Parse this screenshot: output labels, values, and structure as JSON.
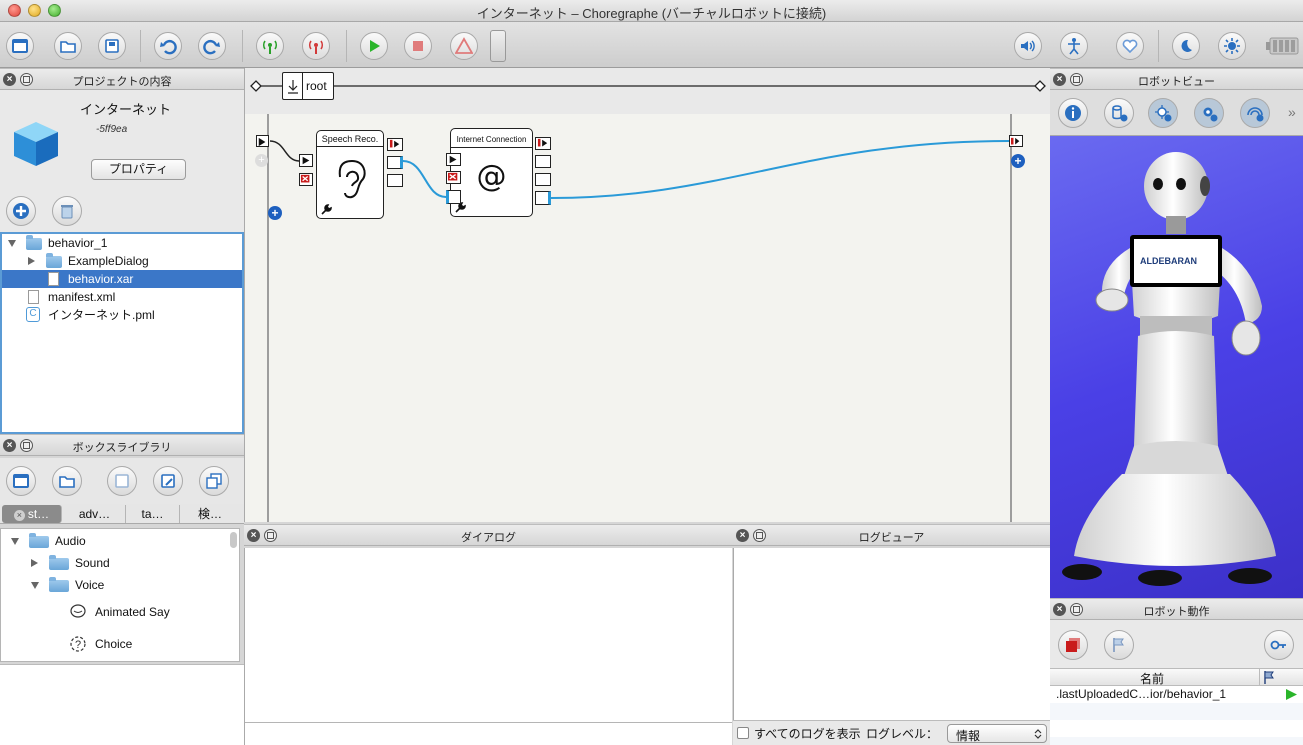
{
  "window": {
    "title": "インターネット – Choregraphe (バーチャルロボットに接続)"
  },
  "toolbar": {
    "icons": [
      "new-file-icon",
      "open-folder-icon",
      "save-icon",
      "undo-icon",
      "redo-icon",
      "connect-icon",
      "disconnect-icon",
      "play-icon",
      "stop-icon",
      "debug-icon",
      "volume-icon",
      "robot-posture-icon",
      "heart-icon",
      "moon-icon",
      "sun-icon",
      "battery-icon"
    ]
  },
  "project_panel": {
    "title": "プロジェクトの内容",
    "project_name": "インターネット",
    "project_id": "-5ff9ea",
    "properties_button": "プロパティ",
    "tree": [
      {
        "label": "behavior_1",
        "type": "folder",
        "expanded": true,
        "level": 0
      },
      {
        "label": "ExampleDialog",
        "type": "folder",
        "expanded": false,
        "level": 1
      },
      {
        "label": "behavior.xar",
        "type": "file",
        "selected": true,
        "level": 1
      },
      {
        "label": "manifest.xml",
        "type": "file",
        "level": 0
      },
      {
        "label": "インターネット.pml",
        "type": "pml",
        "level": 0
      }
    ]
  },
  "box_library": {
    "title": "ボックスライブラリ",
    "tabs": [
      "st…",
      "adv…",
      "ta…",
      "検…"
    ],
    "tree": [
      {
        "label": "Audio",
        "type": "folder",
        "expanded": true
      },
      {
        "label": "Sound",
        "type": "folder",
        "expanded": false
      },
      {
        "label": "Voice",
        "type": "folder",
        "expanded": true
      },
      {
        "label": "Animated Say",
        "type": "box"
      },
      {
        "label": "Choice",
        "type": "box"
      }
    ]
  },
  "flow": {
    "breadcrumb": "root",
    "boxes": [
      {
        "title": "Speech Reco.",
        "icon": "ear-icon"
      },
      {
        "title": "Internet Connection",
        "icon": "at-icon",
        "glyph": "@"
      }
    ]
  },
  "dialog_panel": {
    "title": "ダイアログ"
  },
  "log_panel": {
    "title": "ログビューア",
    "show_all_label": "すべてのログを表示",
    "level_label": "ログレベル：",
    "level_value": "情報"
  },
  "robot_view": {
    "title": "ロボットビュー",
    "tablet_text": "ALDEBARAN",
    "colors": {
      "background": "#4a40e6"
    }
  },
  "robot_motion": {
    "title": "ロボット動作",
    "column_name": "名前",
    "rows": [
      {
        "name": ".lastUploadedC…ior/behavior_1"
      }
    ]
  }
}
